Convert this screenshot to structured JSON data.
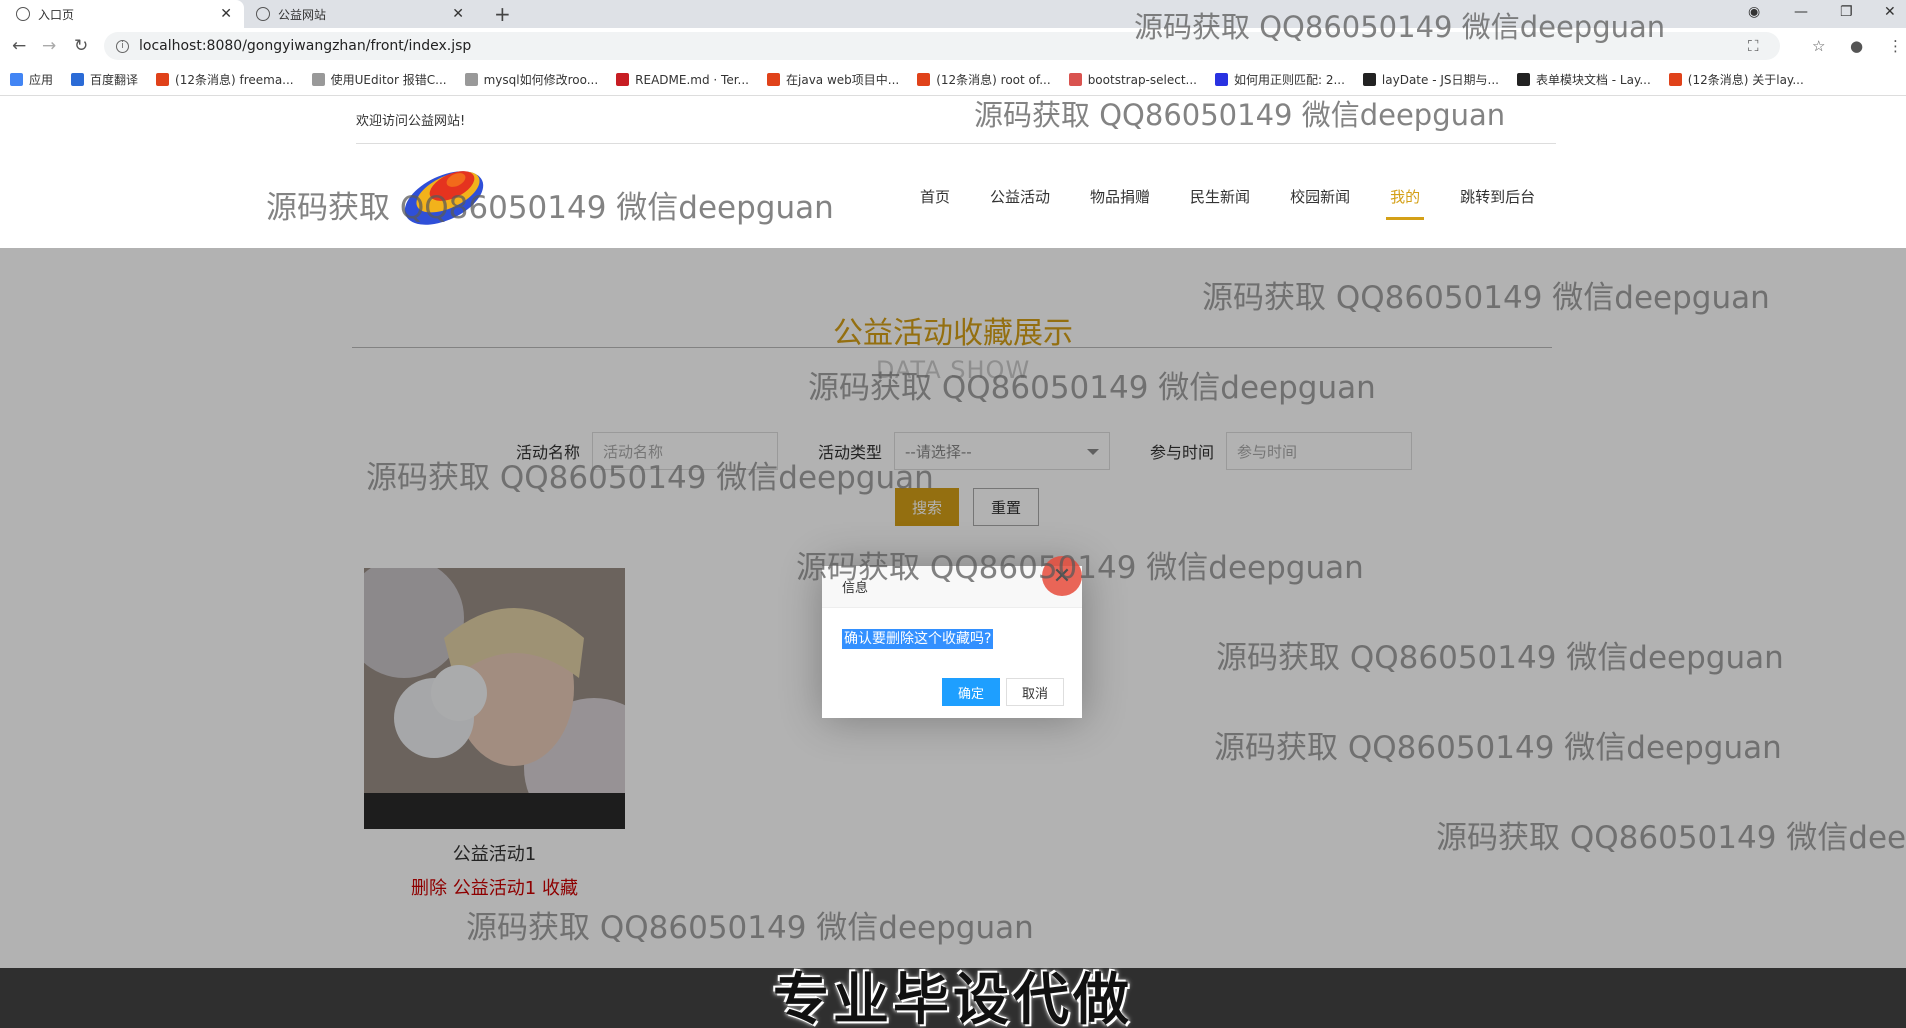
{
  "browser": {
    "tabs": [
      {
        "title": "入口页",
        "active": true
      },
      {
        "title": "公益网站",
        "active": false
      }
    ],
    "url": "localhost:8080/gongyiwangzhan/front/index.jsp",
    "bookmarks": [
      "应用",
      "百度翻译",
      "(12条消息) freema...",
      "使用UEditor 报错C...",
      "mysql如何修改roo...",
      "README.md · Ter...",
      "在java web项目中...",
      "(12条消息) root of...",
      "bootstrap-select...",
      "如何用正则匹配: 2...",
      "layDate - JS日期与...",
      "表单模块文档 - Lay...",
      "(12条消息) 关于lay..."
    ]
  },
  "site": {
    "welcome": "欢迎访问公益网站!",
    "nav": [
      "首页",
      "公益活动",
      "物品捐赠",
      "民生新闻",
      "校园新闻",
      "我的",
      "跳转到后台"
    ],
    "active_nav": "我的"
  },
  "section": {
    "title": "公益活动收藏展示",
    "subtitle": "DATA SHOW"
  },
  "filters": {
    "name_label": "活动名称",
    "name_placeholder": "活动名称",
    "type_label": "活动类型",
    "type_value": "--请选择--",
    "time_label": "参与时间",
    "time_placeholder": "参与时间",
    "search_label": "搜索",
    "reset_label": "重置"
  },
  "cards": [
    {
      "title": "公益活动1",
      "delete_text": "删除 公益活动1 收藏"
    }
  ],
  "dialog": {
    "title": "信息",
    "message": "确认要删除这个收藏吗?",
    "ok_label": "确定",
    "cancel_label": "取消"
  },
  "watermark": "源码获取 QQ86050149 微信deepguan",
  "caption": "专业毕设代做",
  "colors": {
    "accent": "#d4a017",
    "dialog_ok": "#1e9fff",
    "delete": "#cc0000"
  }
}
